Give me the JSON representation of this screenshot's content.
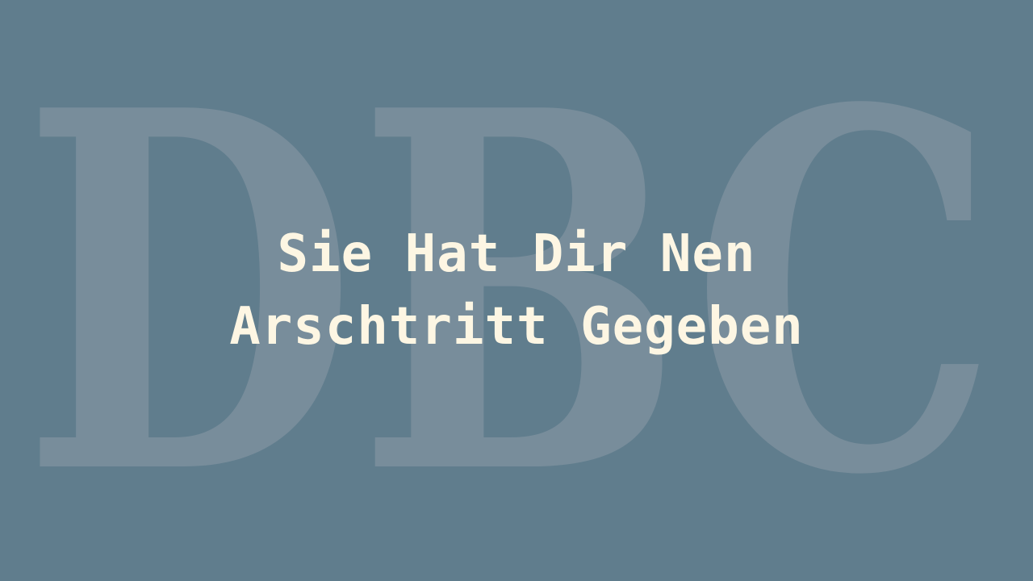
{
  "background_logo": {
    "text": "DBC"
  },
  "title": {
    "line1": "Sie Hat Dir Nen",
    "line2": "Arschtritt Gegeben"
  },
  "colors": {
    "background": "#607d8d",
    "logo_letters": "#788d9b",
    "title_text": "#fdf6e3"
  }
}
